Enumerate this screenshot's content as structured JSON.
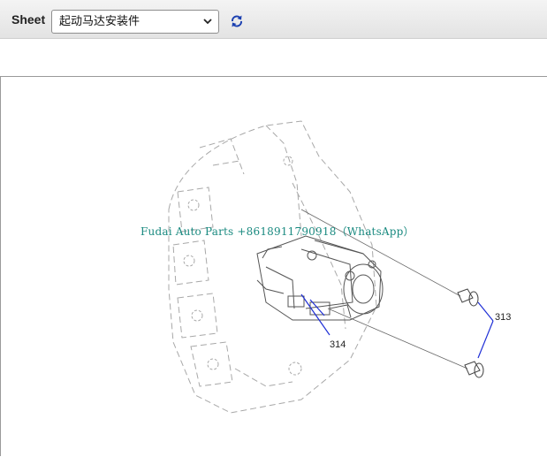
{
  "toolbar": {
    "sheet_label": "Sheet",
    "sheet_selected": "起动马达安装件",
    "refresh_icon": "refresh-icon"
  },
  "diagram": {
    "watermark": "Fudai Auto Parts +8618911790918（WhatsApp）",
    "callouts": [
      "313",
      "314"
    ],
    "leader_color": "#1f2fd6",
    "icons": [
      "chevron-down-icon",
      "refresh-icon"
    ]
  }
}
